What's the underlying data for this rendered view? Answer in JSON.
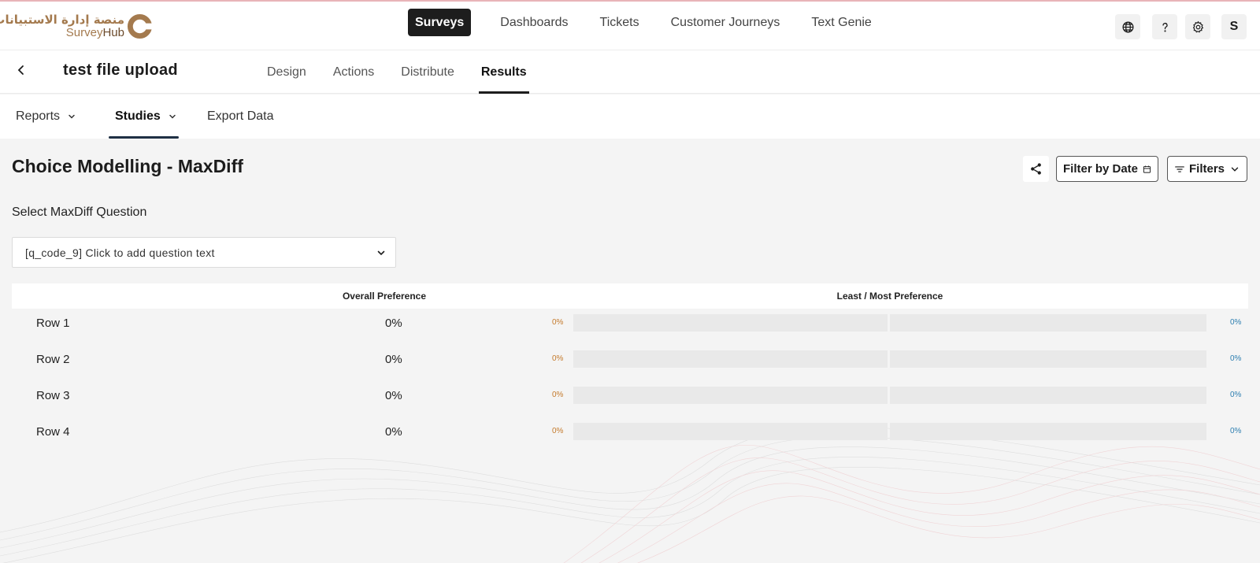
{
  "brand": {
    "arabic_name": "منصة إدارة الاستبيانات",
    "name_part1": "Survey",
    "name_part2": "Hub",
    "color": "#a47a4e"
  },
  "top_nav": {
    "items": [
      {
        "label": "Surveys",
        "active": true
      },
      {
        "label": "Dashboards",
        "active": false
      },
      {
        "label": "Tickets",
        "active": false
      },
      {
        "label": "Customer Journeys",
        "active": false
      },
      {
        "label": "Text Genie",
        "active": false
      }
    ],
    "utilities": [
      "globe-icon",
      "help-icon",
      "gear-icon"
    ],
    "avatar_initial": "S"
  },
  "survey": {
    "title": "test file upload",
    "tabs": [
      {
        "label": "Design",
        "active": false
      },
      {
        "label": "Actions",
        "active": false
      },
      {
        "label": "Distribute",
        "active": false
      },
      {
        "label": "Results",
        "active": true
      }
    ]
  },
  "results_nav": {
    "items": [
      {
        "label": "Reports",
        "has_dropdown": true,
        "active": false
      },
      {
        "label": "Studies",
        "has_dropdown": true,
        "active": true
      },
      {
        "label": "Export Data",
        "has_dropdown": false,
        "active": false
      }
    ]
  },
  "page": {
    "title": "Choice Modelling - MaxDiff",
    "filter_by_date_label": "Filter by Date",
    "filters_label": "Filters",
    "select_label": "Select MaxDiff Question",
    "selected_question": "[q_code_9] Click to add question text"
  },
  "table": {
    "col_overall": "Overall Preference",
    "col_least_most": "Least / Most Preference",
    "least_color": "#c47a2c",
    "most_color": "#2d7eb0",
    "rows": [
      {
        "label": "Row 1",
        "overall": "0%",
        "least": "0%",
        "most": "0%",
        "least_value": 0,
        "most_value": 0
      },
      {
        "label": "Row 2",
        "overall": "0%",
        "least": "0%",
        "most": "0%",
        "least_value": 0,
        "most_value": 0
      },
      {
        "label": "Row 3",
        "overall": "0%",
        "least": "0%",
        "most": "0%",
        "least_value": 0,
        "most_value": 0
      },
      {
        "label": "Row 4",
        "overall": "0%",
        "least": "0%",
        "most": "0%",
        "least_value": 0,
        "most_value": 0
      }
    ]
  }
}
